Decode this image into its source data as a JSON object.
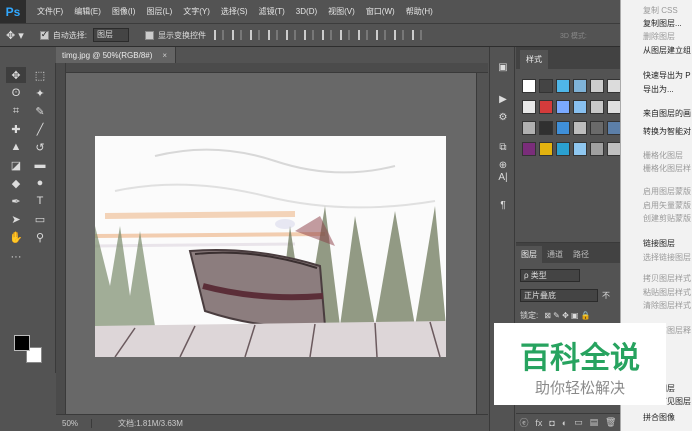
{
  "app": {
    "logo": "Ps"
  },
  "menu": [
    "文件(F)",
    "编辑(E)",
    "图像(I)",
    "图层(L)",
    "文字(Y)",
    "选择(S)",
    "滤镜(T)",
    "3D(D)",
    "视图(V)",
    "窗口(W)",
    "帮助(H)"
  ],
  "options": {
    "auto_select_label": "自动选择:",
    "auto_select_checked": true,
    "auto_select_value": "图层",
    "transform_label": "显示变换控件",
    "transform_checked": false,
    "mode_3d_label": "3D 模式:"
  },
  "document": {
    "tab_label": "timg.jpg @ 50%(RGB/8#)",
    "close_glyph": "×",
    "zoom": "50%",
    "doc_info": "文档:1.81M/3.63M"
  },
  "tools": [
    {
      "name": "move-tool",
      "glyph": "✥"
    },
    {
      "name": "marquee-tool",
      "glyph": "⬚"
    },
    {
      "name": "lasso-tool",
      "glyph": "ʘ"
    },
    {
      "name": "magic-wand-tool",
      "glyph": "✦"
    },
    {
      "name": "crop-tool",
      "glyph": "⌗"
    },
    {
      "name": "eyedropper-tool",
      "glyph": "✎"
    },
    {
      "name": "healing-tool",
      "glyph": "✚"
    },
    {
      "name": "brush-tool",
      "glyph": "╱"
    },
    {
      "name": "stamp-tool",
      "glyph": "▲"
    },
    {
      "name": "history-brush-tool",
      "glyph": "↺"
    },
    {
      "name": "eraser-tool",
      "glyph": "◪"
    },
    {
      "name": "gradient-tool",
      "glyph": "▬"
    },
    {
      "name": "blur-tool",
      "glyph": "◆"
    },
    {
      "name": "dodge-tool",
      "glyph": "●"
    },
    {
      "name": "pen-tool",
      "glyph": "✒"
    },
    {
      "name": "type-tool",
      "glyph": "T"
    },
    {
      "name": "path-select-tool",
      "glyph": "➤"
    },
    {
      "name": "shape-tool",
      "glyph": "▭"
    },
    {
      "name": "hand-tool",
      "glyph": "✋"
    },
    {
      "name": "zoom-tool",
      "glyph": "⚲"
    },
    {
      "name": "extra-tools",
      "glyph": "···"
    }
  ],
  "strip_icons": [
    {
      "name": "history-icon",
      "glyph": "▣"
    },
    {
      "name": "actions-play-icon",
      "glyph": "▶"
    },
    {
      "name": "adjust-icon",
      "glyph": "⚙"
    },
    {
      "name": "clone-source-icon",
      "glyph": "⧉"
    },
    {
      "name": "brush-settings-icon",
      "glyph": "⊕"
    },
    {
      "name": "character-icon",
      "glyph": "A|"
    },
    {
      "name": "paragraph-icon",
      "glyph": "¶"
    }
  ],
  "styles_panel": {
    "tab": "样式"
  },
  "style_swatches": [
    "#ffffff",
    "#444444",
    "#4fb6e8",
    "#7fb3d8",
    "#cccccc",
    "#dcdcdc",
    "#e8e8e8",
    "#d43b3b",
    "#7aa9ff",
    "#88c0f0",
    "#c8c8c8",
    "#e0e0e0",
    "#b0b0b0",
    "#303030",
    "#3f8fd8",
    "#bdbdbd",
    "#6a6a6a",
    "#5c7fa8",
    "#7a2d7a",
    "#e3b20f",
    "#2aa0d0",
    "#8fc7f0",
    "#a0a0a0",
    "#c0c0c0"
  ],
  "layers_panel": {
    "tabs": [
      "图层",
      "通道",
      "路径"
    ],
    "kind_label": "ρ 类型",
    "blend_mode": "正片叠底",
    "opacity_label": "不",
    "lock_label": "锁定:",
    "footer_icons": [
      "ⓔ",
      "fx",
      "◘",
      "◐",
      "▭",
      "▤",
      "🗑"
    ]
  },
  "context_menu": {
    "items": [
      {
        "label": "复制 CSS",
        "enabled": false
      },
      {
        "label": "复制图层...",
        "enabled": true
      },
      {
        "label": "删除图层",
        "enabled": false
      },
      {
        "label": "从图层建立组",
        "enabled": true
      },
      {
        "label": "快速导出为 P",
        "enabled": true
      },
      {
        "label": "导出为...",
        "enabled": true
      },
      {
        "label": "来自图层的画",
        "enabled": true
      },
      {
        "label": "转换为智能对",
        "enabled": true
      },
      {
        "label": "栅格化图层",
        "enabled": false
      },
      {
        "label": "栅格化图层样",
        "enabled": false
      },
      {
        "label": "启用图层蒙版",
        "enabled": false
      },
      {
        "label": "启用矢量蒙版",
        "enabled": false
      },
      {
        "label": "创建剪贴蒙版",
        "enabled": false
      },
      {
        "label": "链接图层",
        "enabled": true
      },
      {
        "label": "选择链接图层",
        "enabled": false
      },
      {
        "label": "拷贝图层样式",
        "enabled": false
      },
      {
        "label": "粘贴图层样式",
        "enabled": false
      },
      {
        "label": "清除图层样式",
        "enabled": false
      },
      {
        "label": "从隔离图层释",
        "enabled": false
      },
      {
        "label": "合并图层",
        "enabled": true
      },
      {
        "label": "合并可见图层",
        "enabled": true
      },
      {
        "label": "拼合图像",
        "enabled": true
      }
    ]
  },
  "watermark": {
    "title": "百科全说",
    "subtitle": "助你轻松解决"
  }
}
